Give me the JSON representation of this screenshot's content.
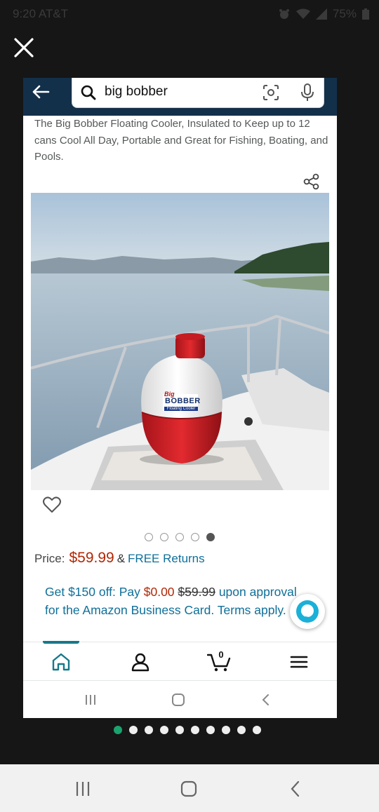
{
  "status_bar": {
    "time": "9:20 AT&T",
    "battery": "75%",
    "icons": [
      "alarm-icon",
      "wifi-icon",
      "signal-icon",
      "battery-icon"
    ]
  },
  "search": {
    "query": "big bobber",
    "icons": [
      "back-arrow-icon",
      "search-icon",
      "camera-scan-icon",
      "microphone-icon"
    ]
  },
  "product": {
    "title": "The Big Bobber Floating Cooler, Insulated to Keep up to 12 cans Cool All Day, Portable and Great for Fishing, Boating, and Pools.",
    "image_label_top": "Big",
    "image_label_main": "BOBBER",
    "image_label_sub": "Floating Cooler",
    "carousel": {
      "count": 5,
      "active_index": 5
    }
  },
  "price": {
    "label": "Price:",
    "amount": "$59.99",
    "amp": "&",
    "free_returns": "FREE Returns"
  },
  "offer": {
    "prefix": "Get $150 off: Pay ",
    "pay_amount": "$0.00",
    "strike_amount": "$59.99",
    "suffix": " upon approval for the Amazon Business Card.",
    "terms": "Terms apply."
  },
  "navbar": {
    "items": [
      "home-icon",
      "account-icon",
      "cart-icon",
      "menu-icon"
    ],
    "active": "home",
    "cart_count": "0"
  },
  "pager": {
    "count": 10,
    "active_index": 1
  },
  "colors": {
    "topbar": "#13304a",
    "price": "#b12704",
    "link": "#0f6f99",
    "accent": "#16788a",
    "pager_active": "#1aa36e"
  }
}
